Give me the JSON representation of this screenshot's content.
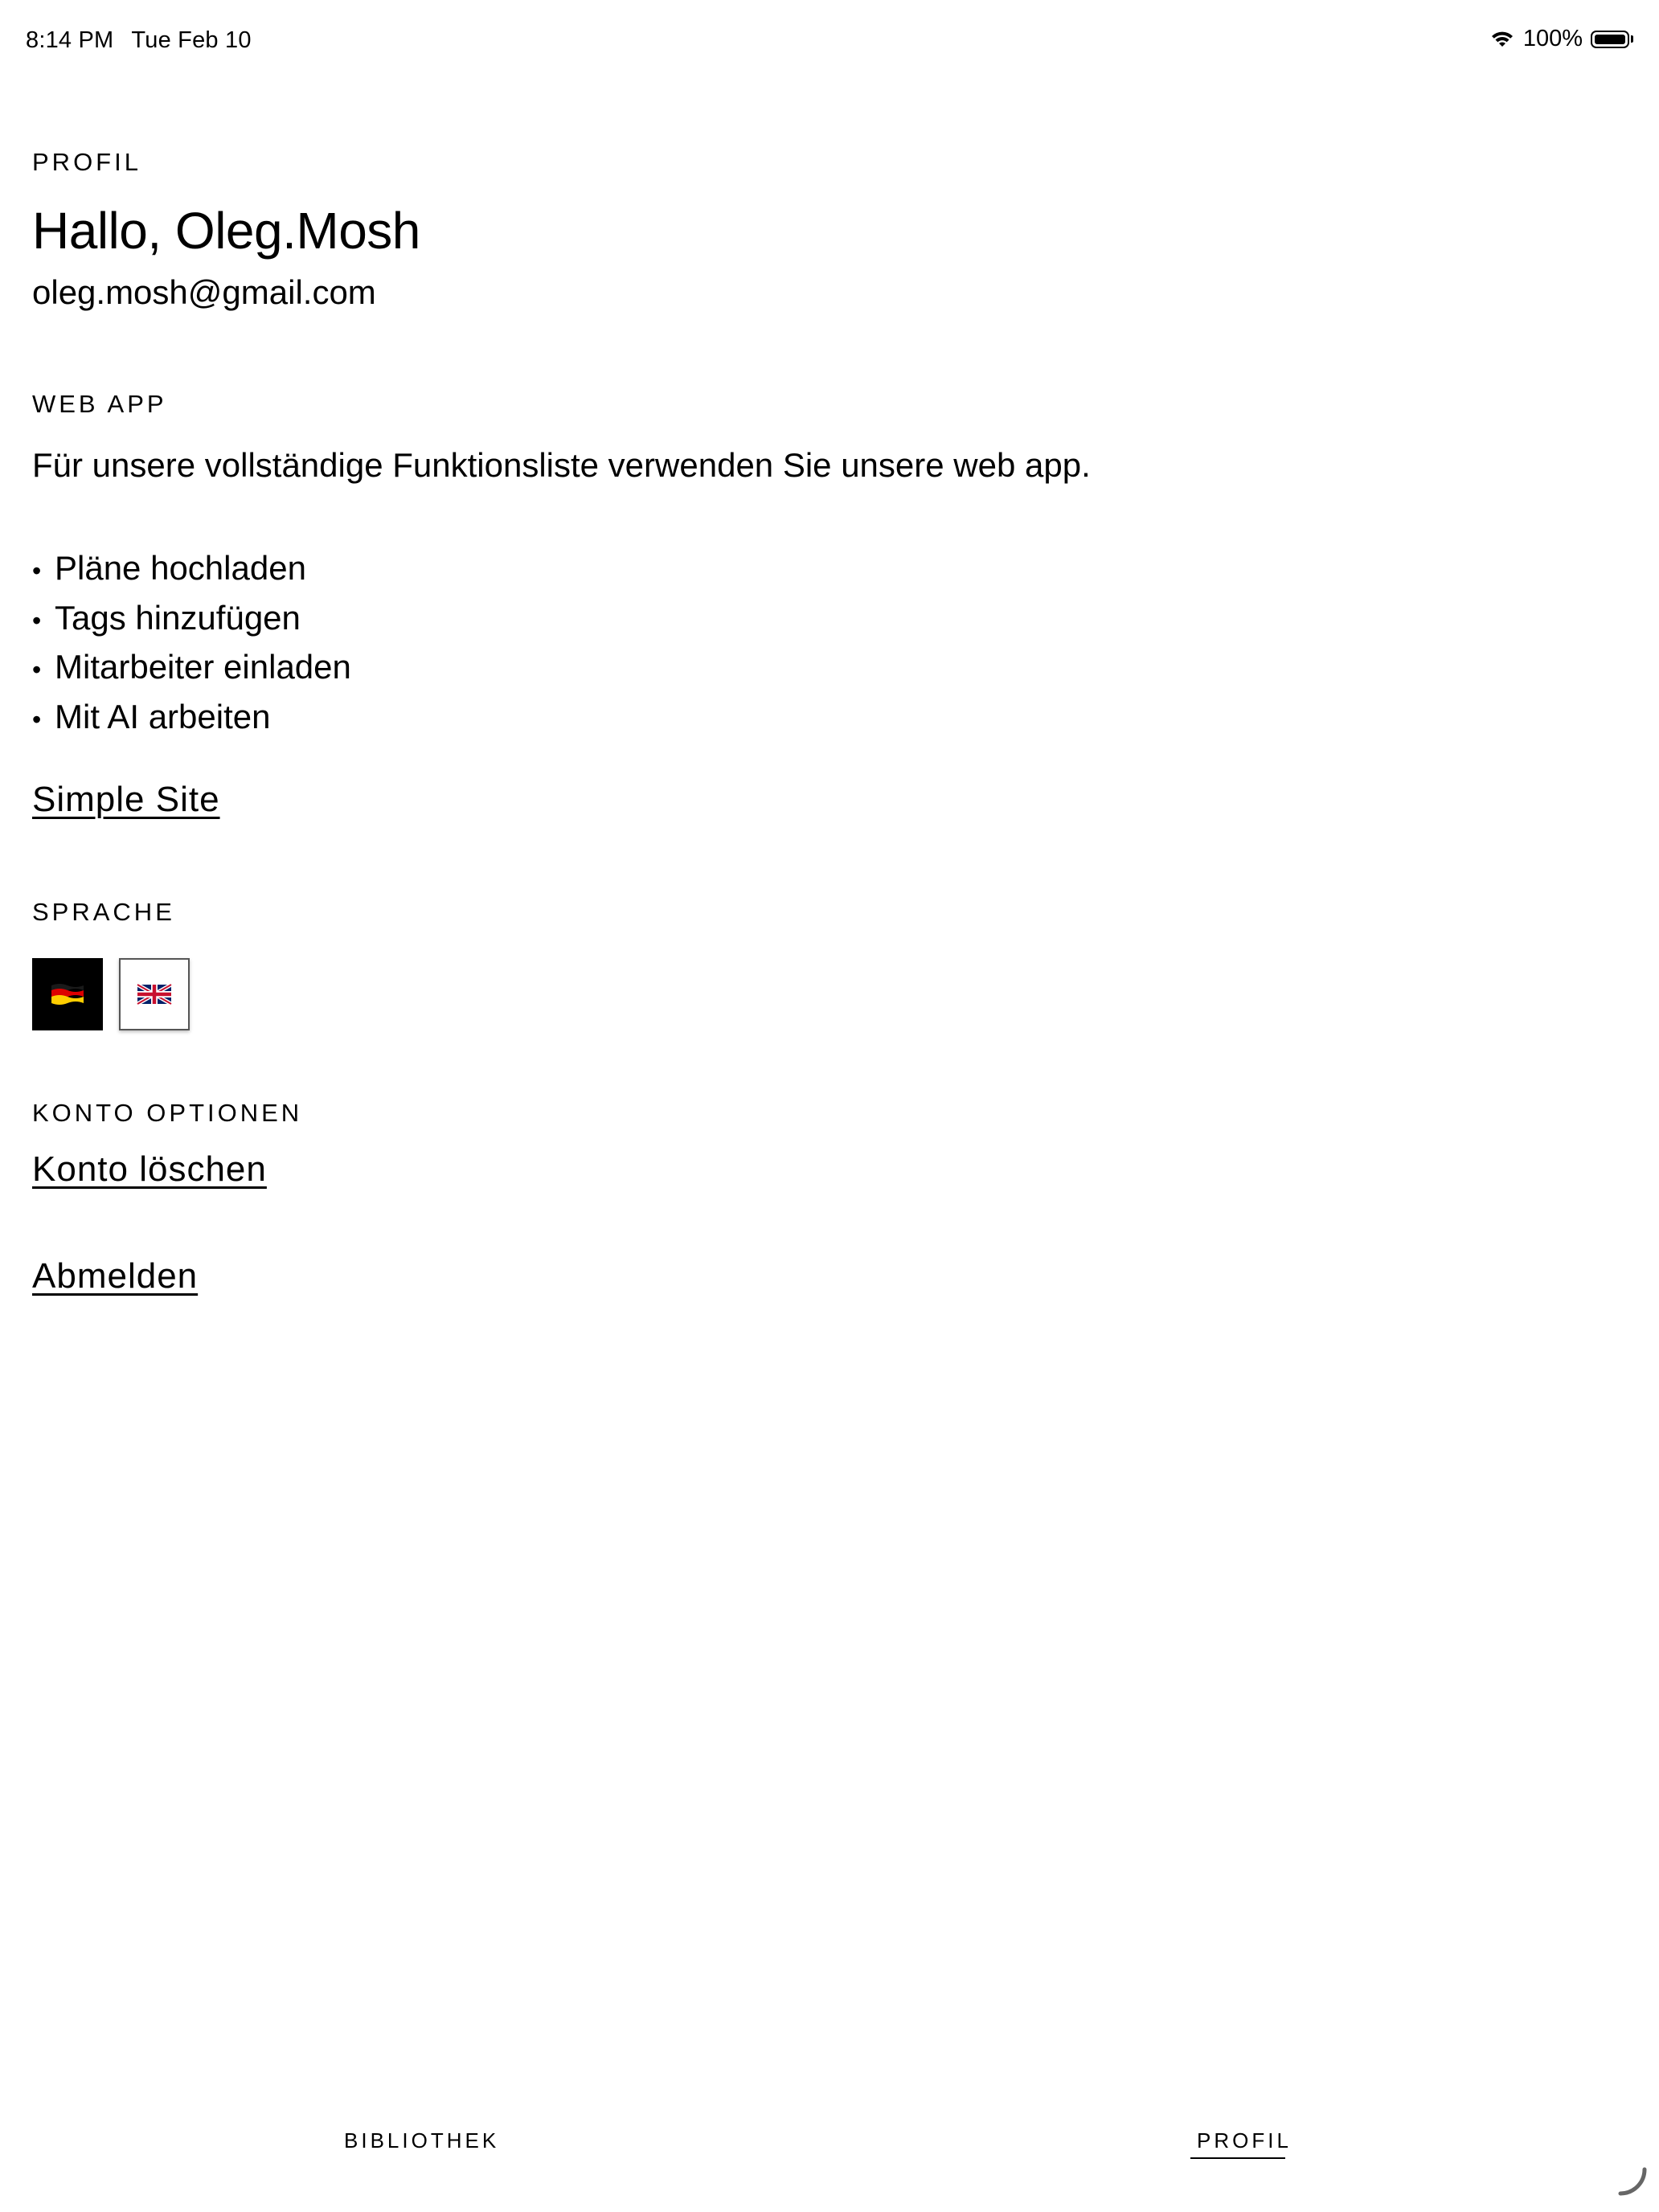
{
  "status_bar": {
    "time": "8:14 PM",
    "date": "Tue Feb 10",
    "battery_text": "100%",
    "battery_level": 1.0,
    "wifi_icon": "wifi-icon",
    "battery_icon": "battery-icon"
  },
  "profile": {
    "section_label": "PROFIL",
    "greeting": "Hallo, Oleg.Mosh",
    "email": "oleg.mosh@gmail.com"
  },
  "webapp": {
    "section_label": "WEB APP",
    "description": "Für unsere vollständige Funktionsliste verwenden Sie unsere web app.",
    "bullet": "•",
    "features": [
      "Pläne hochladen",
      "Tags hinzufügen",
      "Mitarbeiter einladen",
      "Mit AI arbeiten"
    ],
    "link_label": "Simple Site"
  },
  "language": {
    "section_label": "SPRACHE",
    "options": [
      {
        "code": "de",
        "icon": "german-flag-icon",
        "selected": true
      },
      {
        "code": "en",
        "icon": "uk-flag-icon",
        "selected": false
      }
    ]
  },
  "account": {
    "section_label": "KONTO OPTIONEN",
    "delete_label": "Konto löschen",
    "logout_label": "Abmelden"
  },
  "tabs": [
    {
      "label": "BIBLIOTHEK",
      "active": false
    },
    {
      "label": "PROFIL",
      "active": true
    }
  ],
  "colors": {
    "text": "#000000",
    "background": "#ffffff",
    "active_lang_bg": "#000000"
  }
}
